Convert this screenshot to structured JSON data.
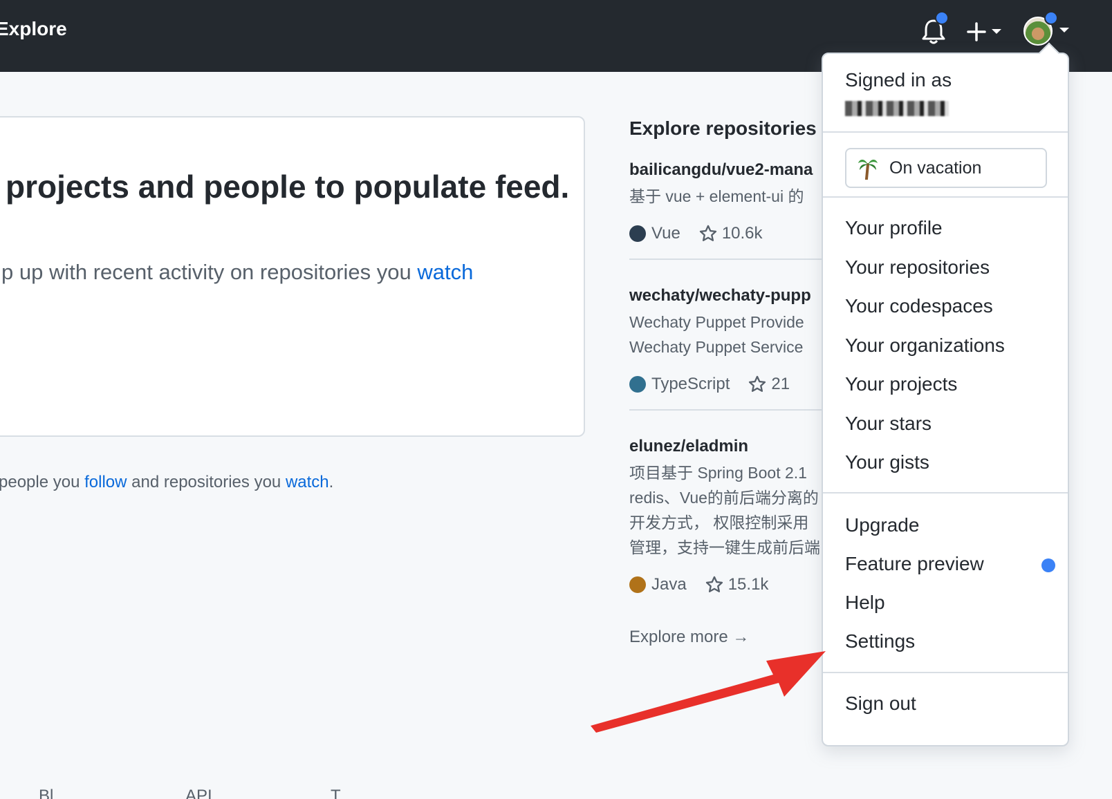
{
  "header": {
    "title": "Explore"
  },
  "feed": {
    "title": "projects and people to populate feed.",
    "subtitle_prefix": "p up with recent activity on repositories you ",
    "subtitle_link": "watch",
    "footnote_prefix": "people you ",
    "footnote_follow": "follow",
    "footnote_middle": " and repositories you ",
    "footnote_watch": "watch",
    "footnote_suffix": "."
  },
  "explore": {
    "heading": "Explore repositories",
    "repos": [
      {
        "name": "bailicangdu/vue2-mana",
        "desc_lines": [
          "基于 vue + element-ui 的"
        ],
        "language": "Vue",
        "lang_color": "#2c3e50",
        "stars": "10.6k"
      },
      {
        "name": "wechaty/wechaty-pupp",
        "desc_lines": [
          "Wechaty Puppet Provide",
          "Wechaty Puppet Service"
        ],
        "language": "TypeScript",
        "lang_color": "#31708f",
        "stars": "21"
      },
      {
        "name": "elunez/eladmin",
        "desc_lines": [
          "项目基于 Spring Boot 2.1",
          "redis、Vue的前后端分离的",
          "开发方式， 权限控制采用",
          "管理，支持一键生成前后端"
        ],
        "language": "Java",
        "lang_color": "#b07219",
        "stars": "15.1k"
      }
    ],
    "more": "Explore more →"
  },
  "dropdown": {
    "signed_in_as": "Signed in as",
    "status": "On vacation",
    "profile_items": [
      "Your profile",
      "Your repositories",
      "Your codespaces",
      "Your organizations",
      "Your projects",
      "Your stars",
      "Your gists"
    ],
    "upgrade": "Upgrade",
    "feature_preview": "Feature preview",
    "help": "Help",
    "settings": "Settings",
    "sign_out": "Sign out"
  },
  "footer": {
    "items": [
      "Bl",
      "API",
      "T"
    ]
  },
  "colors": {
    "header_bg": "#24292f",
    "link": "#0969da",
    "notification_dot": "#3b82f6",
    "annotation_arrow": "#e8302a"
  }
}
